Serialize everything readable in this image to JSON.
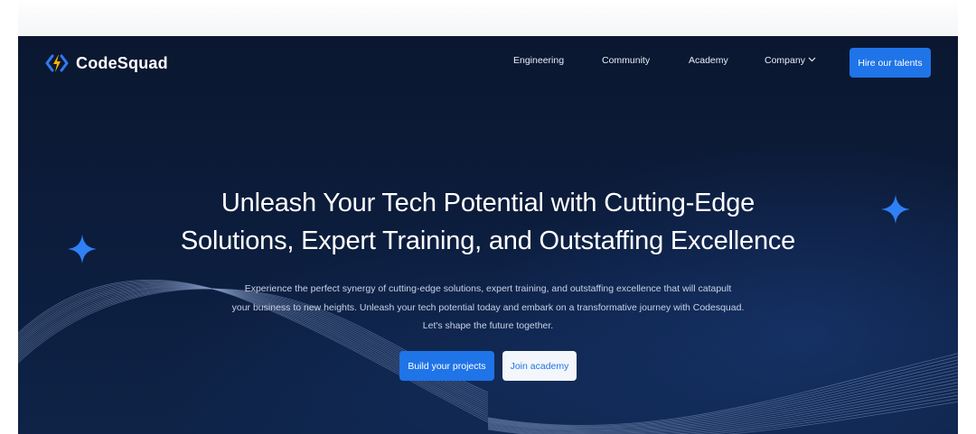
{
  "brand": {
    "name": "CodeSquad",
    "accent": "#1f74e8",
    "logo_colors": [
      "#2f7bf0",
      "#f5b400"
    ]
  },
  "nav": {
    "links": [
      {
        "label": "Engineering"
      },
      {
        "label": "Community"
      },
      {
        "label": "Academy"
      },
      {
        "label": "Company",
        "icon": "chevron-down-icon"
      }
    ],
    "cta_label": "Hire our talents"
  },
  "hero": {
    "title_line1": "Unleash Your Tech Potential with Cutting-Edge",
    "title_line2": "Solutions, Expert Training, and Outstaffing Excellence",
    "sub_line1": "Experience the perfect synergy of cutting-edge solutions, expert training, and outstaffing excellence that will catapult",
    "sub_line2": "your business to new heights. Unleash your tech potential today and embark on a transformative journey with Codesquad.",
    "sub_line3": "Let's shape the future together.",
    "primary_cta": "Build your projects",
    "secondary_cta": "Join academy"
  },
  "decor": {
    "sparkle_icon": "four-point-star-icon",
    "sparkle_color": "#2f80f5",
    "background": "#0c1d3d"
  }
}
